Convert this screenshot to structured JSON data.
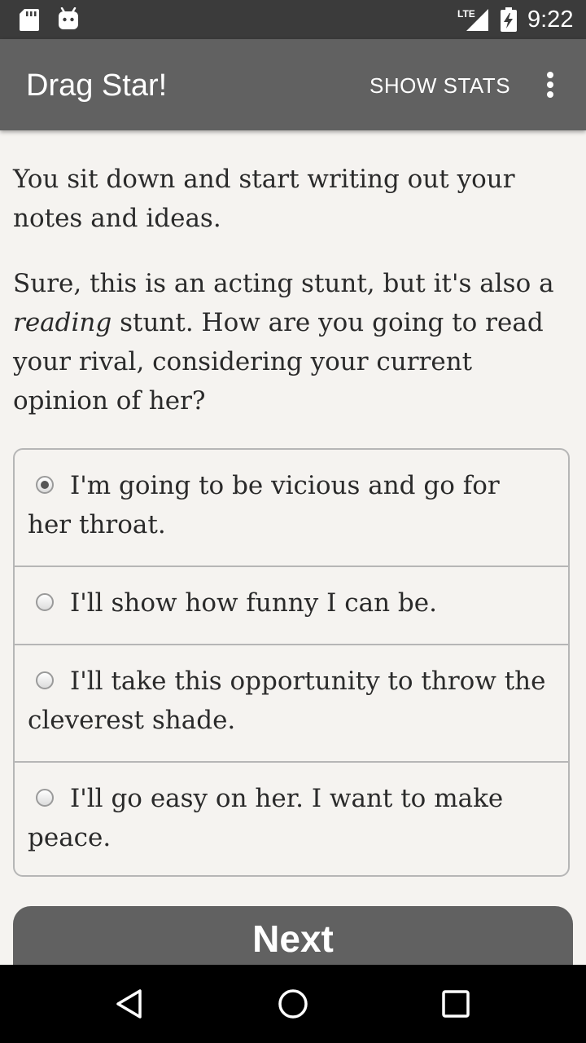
{
  "status_bar": {
    "network": "LTE",
    "time": "9:22",
    "icons": [
      "sd-card-icon",
      "android-icon",
      "lte-signal-icon",
      "battery-charging-icon"
    ]
  },
  "app_bar": {
    "title": "Drag Star!",
    "show_stats_label": "SHOW STATS",
    "overflow_icon": "more-vert-icon"
  },
  "story": {
    "paragraph1": "You sit down and start writing out your notes and ideas.",
    "paragraph2_italic": "reading",
    "paragraph2_prefix": "Sure, this is an acting stunt, but it's also a ",
    "paragraph2_suffix": " stunt. How are you going to read your rival, considering your current opinion of her?"
  },
  "choices": [
    {
      "label": "I'm going to be vicious and go for her throat.",
      "selected": true
    },
    {
      "label": "I'll show how funny I can be.",
      "selected": false
    },
    {
      "label": "I'll take this opportunity to throw the cleverest shade.",
      "selected": false
    },
    {
      "label": "I'll go easy on her. I want to make peace.",
      "selected": false
    }
  ],
  "next_button_label": "Next",
  "nav_bar": {
    "icons": [
      "back-icon",
      "home-icon",
      "recents-icon"
    ]
  },
  "colors": {
    "status_bar": "#3b3b3b",
    "app_bar": "#616161",
    "background": "#f5f3f0",
    "button": "#616161",
    "border": "#b6b6b6"
  }
}
